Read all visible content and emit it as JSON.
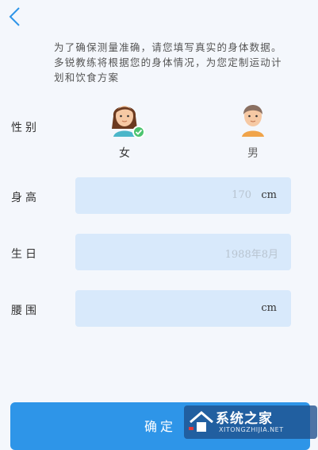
{
  "intro_text": "为了确保测量准确，请您填写真实的身体数据。多锐教练将根据您的身体情况，为您定制运动计划和饮食方案",
  "gender": {
    "label": "性别",
    "female_label": "女",
    "male_label": "男",
    "selected": "女"
  },
  "height": {
    "label": "身高",
    "placeholder": "170",
    "unit": "cm"
  },
  "birthday": {
    "label": "生日",
    "placeholder": "1988年8月"
  },
  "waist": {
    "label": "腰围",
    "unit": "cm"
  },
  "confirm_label": "确定",
  "watermark": {
    "title": "系统之家",
    "url": "XITONGZHIJIA.NET"
  },
  "colors": {
    "accent": "#2e95e8",
    "field_bg": "#d8e9fb",
    "check_green": "#4cc46f"
  }
}
